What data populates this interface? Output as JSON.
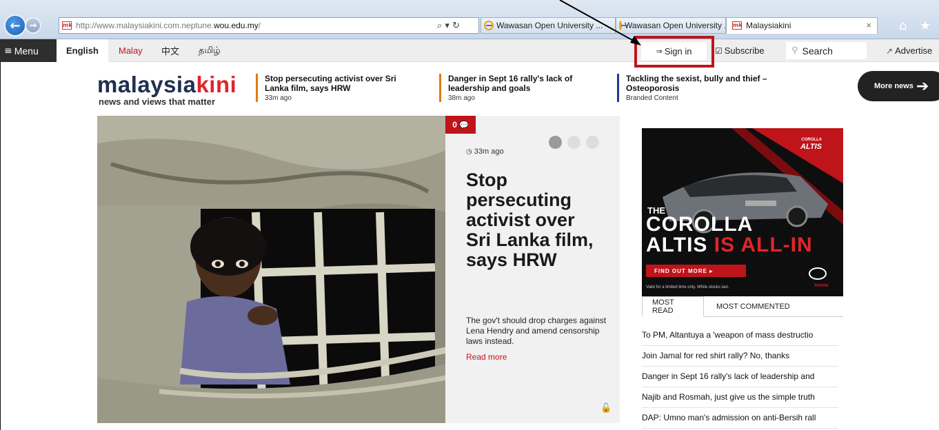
{
  "browser": {
    "url_prefix": "http://www.malaysiakini.com.neptune.",
    "url_domain": "wou.edu.my",
    "url_suffix": "/",
    "address_icons": "⌕ ▾ ↻",
    "favicon_label": "mk",
    "tabs": [
      {
        "title": "Wawasan Open University ..."
      },
      {
        "title": "Wawasan Open University ..."
      },
      {
        "title": "Malaysiakini",
        "active": true
      }
    ],
    "close_glyph": "×"
  },
  "site_nav": {
    "menu_label": "Menu",
    "languages": [
      "English",
      "Malay",
      "中文",
      "தமிழ்"
    ],
    "sign_in": "Sign in",
    "subscribe": "Subscribe",
    "search_placeholder": "Search",
    "advertise": "Advertise"
  },
  "logo": {
    "main_a": "malaysia",
    "main_b": "kini",
    "tagline": "news and views that matter"
  },
  "headlines": [
    {
      "title": "Stop persecuting activist over Sri Lanka film, says HRW",
      "meta": "33m ago",
      "color": "#e07a10"
    },
    {
      "title": "Danger in Sept 16 rally's lack of leadership and goals",
      "meta": "38m ago",
      "color": "#e07a10"
    },
    {
      "title": "Tackling the sexist, bully and thief – Osteoporosis",
      "meta": "Branded Content",
      "color": "#1d3b8a"
    }
  ],
  "more_news": "More news",
  "hero": {
    "comment_count": "0",
    "time": "33m ago",
    "title": "Stop persecuting activist over Sri Lanka film, says HRW",
    "summary": "The gov't should drop charges against Lena Hendry and amend censorship laws instead.",
    "read_more": "Read more"
  },
  "ad": {
    "brand_small": "COROLLA",
    "brand": "ALTIS",
    "the": "THE",
    "line1": "COROLLA",
    "line2_a": "ALTIS ",
    "line2_b": "IS ALL-IN",
    "cta": "FIND OUT MORE ▸",
    "fine_print": "Valid for a limited time only. While stocks last.",
    "maker": "TOYOTA"
  },
  "list_tabs": {
    "most_read": "MOST READ",
    "most_commented": "MOST COMMENTED"
  },
  "most_read": [
    "To PM, Altantuya a 'weapon of mass destructio",
    "Join Jamal for red shirt rally? No, thanks",
    "Danger in Sept 16 rally's lack of leadership and",
    "Najib and Rosmah, just give us the simple truth",
    "DAP: Umno man's admission on anti-Bersih rall"
  ]
}
